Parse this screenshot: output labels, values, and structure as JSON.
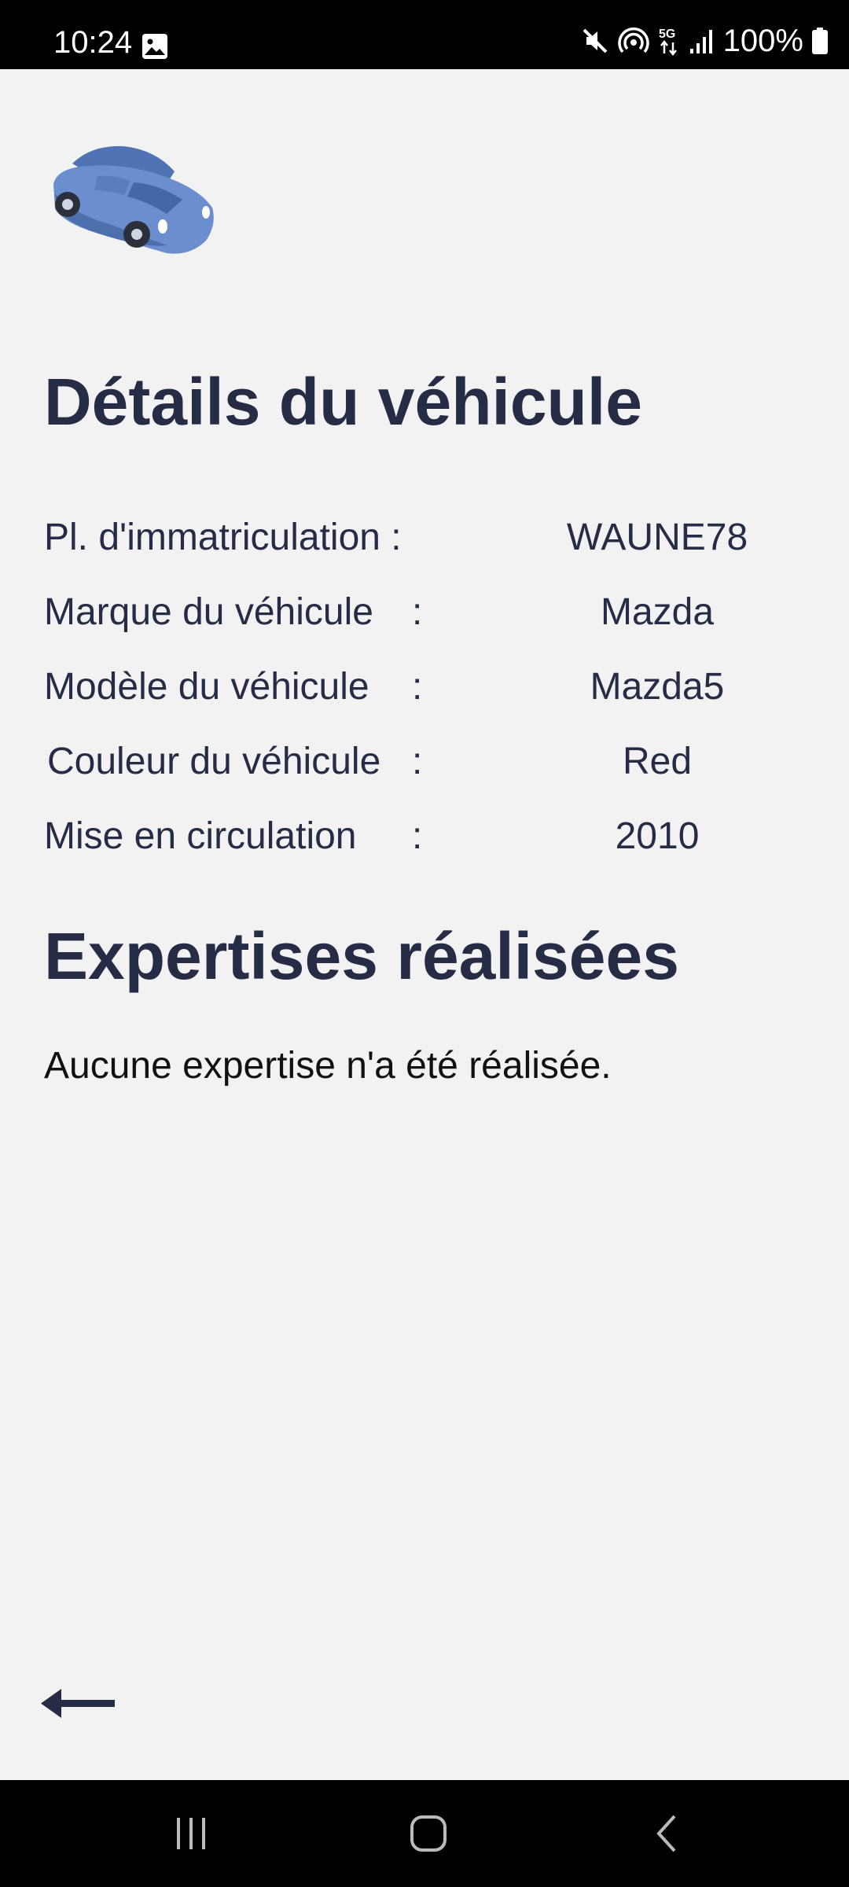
{
  "status_bar": {
    "time": "10:24",
    "battery": "100%",
    "icons": [
      "gallery-icon",
      "mute-icon",
      "hotspot-icon",
      "5g-icon",
      "signal-icon",
      "battery-icon"
    ]
  },
  "header": {
    "logo": "car-icon"
  },
  "details": {
    "title": "Détails du véhicule",
    "rows": [
      {
        "label": "Pl. d'immatriculation :",
        "colon": "",
        "value": "WAUNE78"
      },
      {
        "label": "Marque du véhicule",
        "colon": ":",
        "value": "Mazda"
      },
      {
        "label": "Modèle du véhicule",
        "colon": ":",
        "value": "Mazda5"
      },
      {
        "label": "Couleur du véhicule",
        "colon": ":",
        "value": "Red"
      },
      {
        "label": "Mise en circulation",
        "colon": ":",
        "value": "2010"
      }
    ]
  },
  "expertises": {
    "title": "Expertises réalisées",
    "empty_message": "Aucune expertise n'a été réalisée."
  },
  "navigation": {
    "back_icon": "arrow-left-icon",
    "system_buttons": [
      "recents-icon",
      "home-icon",
      "back-chevron-icon"
    ]
  },
  "colors": {
    "text_primary": "#262c46",
    "background": "#f2f2f2",
    "car_blue": "#6b8fce"
  }
}
